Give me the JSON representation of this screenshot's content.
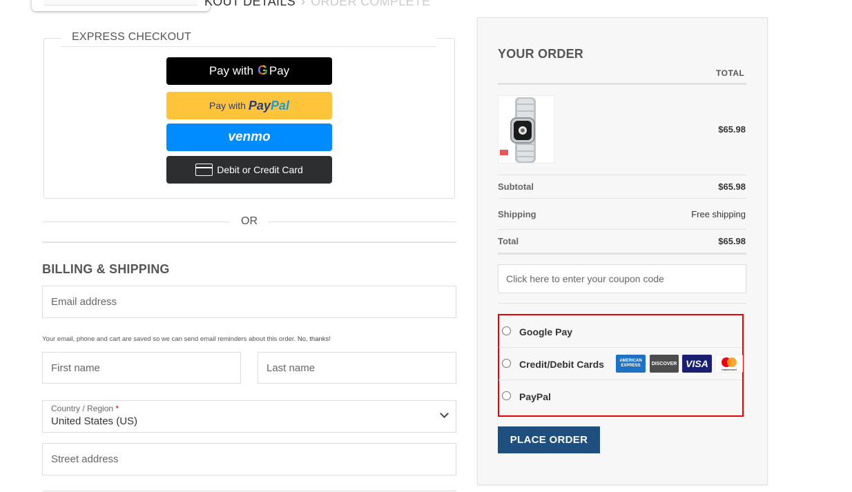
{
  "header": {
    "breadcrumb_current": "KOUT DETAILS",
    "breadcrumb_sep": "›",
    "breadcrumb_next": "ORDER COMPLETE"
  },
  "express": {
    "legend": "EXPRESS CHECKOUT",
    "gpay_prefix": "Pay with",
    "gpay_g": "G",
    "gpay_suffix": "Pay",
    "paypal_prefix": "Pay with",
    "paypal_brand_a": "Pay",
    "paypal_brand_b": "Pal",
    "venmo": "venmo",
    "card": "Debit or Credit Card"
  },
  "or_text": "OR",
  "billing": {
    "title": "BILLING & SHIPPING",
    "email_placeholder": "Email address",
    "notice": "Your email, phone and cart are saved so we can send email reminders about this order.",
    "notice_link": "No, thanks!",
    "first_name_placeholder": "First name",
    "last_name_placeholder": "Last name",
    "country_label": "Country / Region",
    "country_required": "*",
    "country_value": "United States (US)",
    "street_placeholder": "Street address"
  },
  "order": {
    "title": "YOUR ORDER",
    "total_header": "TOTAL",
    "product_price": "$65.98",
    "subtotal_label": "Subtotal",
    "subtotal_value": "$65.98",
    "shipping_label": "Shipping",
    "shipping_value": "Free shipping",
    "total_label": "Total",
    "total_value": "$65.98",
    "coupon_text": "Click here to enter your coupon code",
    "payment_methods": [
      {
        "label": "Google Pay"
      },
      {
        "label": "Credit/Debit Cards"
      },
      {
        "label": "PayPal"
      }
    ],
    "card_logos": {
      "amex": "AMERICAN EXPRESS",
      "discover": "DISCOVER",
      "visa": "VISA",
      "mastercard": "mastercard"
    },
    "place_order": "PLACE ORDER"
  },
  "colors": {
    "accent": "#1f4f7f",
    "highlight_border": "#e00000",
    "paypal_yellow": "#ffc439",
    "venmo_blue": "#008cff"
  }
}
